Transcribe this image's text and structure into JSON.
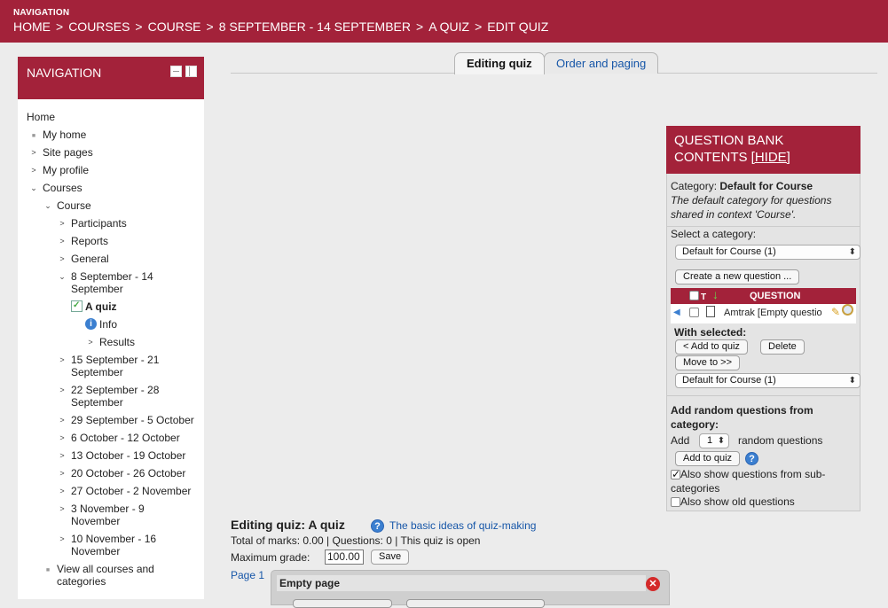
{
  "topbar": {
    "nav_title": "NAVIGATION",
    "breadcrumb": [
      "HOME",
      "COURSES",
      "COURSE",
      "8 SEPTEMBER - 14 SEPTEMBER",
      "A QUIZ",
      "EDIT QUIZ"
    ],
    "separator": ">"
  },
  "nav_block": {
    "title": "NAVIGATION",
    "items": {
      "home": "Home",
      "myhome": "My home",
      "sitepages": "Site pages",
      "myprofile": "My profile",
      "courses": "Courses",
      "course": "Course",
      "participants": "Participants",
      "reports": "Reports",
      "general": "General",
      "week1_a": "8 September - 14",
      "week1_b": "September",
      "aquiz": "A quiz",
      "info": "Info",
      "results": "Results",
      "week2_a": "15 September - 21",
      "week2_b": "September",
      "week3_a": "22 September - 28",
      "week3_b": "September",
      "week4": "29 September - 5 October",
      "week5": "6 October - 12 October",
      "week6": "13 October - 19 October",
      "week7": "20 October - 26 October",
      "week8": "27 October - 2 November",
      "week9_a": "3 November - 9",
      "week9_b": "November",
      "week10_a": "10 November - 16",
      "week10_b": "November",
      "viewall_a": "View all courses and",
      "viewall_b": "categories"
    }
  },
  "tabs": {
    "editing": "Editing quiz",
    "order": "Order and paging"
  },
  "qbank": {
    "header_line1": "QUESTION BANK",
    "header_line2": "CONTENTS",
    "hide": "[HIDE]",
    "category_label": "Category:",
    "category_name": "Default for Course",
    "category_desc_1": "The default category for questions",
    "category_desc_2": "shared in context 'Course'.",
    "select_label": "Select a category:",
    "select_value": "Default for Course (1)",
    "create_button": "Create a new question ...",
    "table_head_t": "T",
    "table_head_question": "QUESTION",
    "question_row": "Amtrak [Empty questio",
    "with_selected": "With selected:",
    "add_to_quiz": "< Add to quiz",
    "delete": "Delete",
    "move_to": "Move to >>",
    "move_select_value": "Default for Course (1)",
    "random_title_1": "Add random questions from",
    "random_title_2": "category:",
    "add_label": "Add",
    "random_count": "1",
    "random_label": "random questions",
    "random_add_button": "Add to quiz",
    "show_sub_1": "Also show questions from sub-",
    "show_sub_2": "categories",
    "show_old": "Also show old questions"
  },
  "main": {
    "editing_title": "Editing quiz: A quiz",
    "help_link": "The basic ideas of quiz-making",
    "totals": "Total of marks: 0.00 | Questions: 0 | This quiz is open",
    "max_grade_label": "Maximum grade:",
    "max_grade_value": "100.00",
    "save": "Save",
    "page_link": "Page 1",
    "empty_page": "Empty page"
  },
  "colors": {
    "brand": "#a3223a",
    "link": "#1656a8"
  }
}
